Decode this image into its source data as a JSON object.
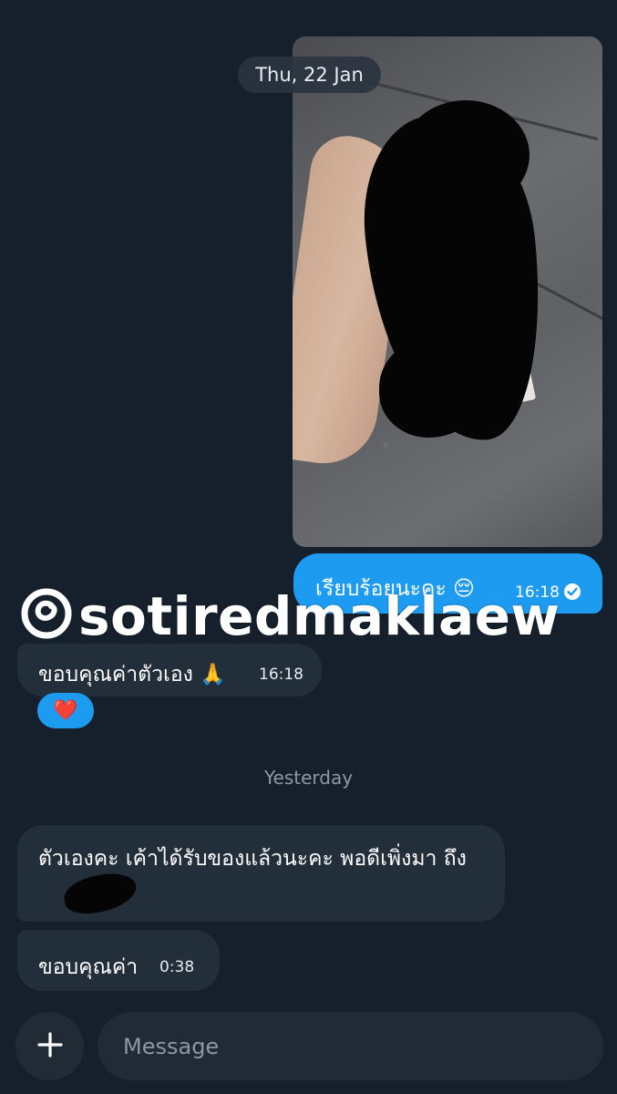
{
  "conversation": {
    "date_separator": "Thu, 22 Jan",
    "outgoing_message": {
      "text": "เรียบร้อยนะคะ 😔",
      "time": "16:18",
      "status_icon": "check-circle-icon"
    },
    "watermark": {
      "icon": "threads-logo-icon",
      "text": "sotiredmaklaew"
    },
    "incoming_message_1": {
      "text": "ขอบคุณค่าตัวเอง 🙏",
      "time": "16:18"
    },
    "reaction": "❤️",
    "day_divider": "Yesterday",
    "incoming_message_2": {
      "text": "ตัวเองคะ เค้าได้รับของแล้วนะคะ พอดีเพิ่งมา ถึง"
    },
    "incoming_message_3": {
      "text": "ขอบคุณค่า",
      "time": "0:38"
    }
  },
  "composer": {
    "add_icon": "plus-icon",
    "placeholder": "Message"
  },
  "colors": {
    "background": "#16202c",
    "outgoing_bubble": "#1d9bf0",
    "incoming_bubble": "#222e3a",
    "muted_text": "#8b98a5"
  }
}
